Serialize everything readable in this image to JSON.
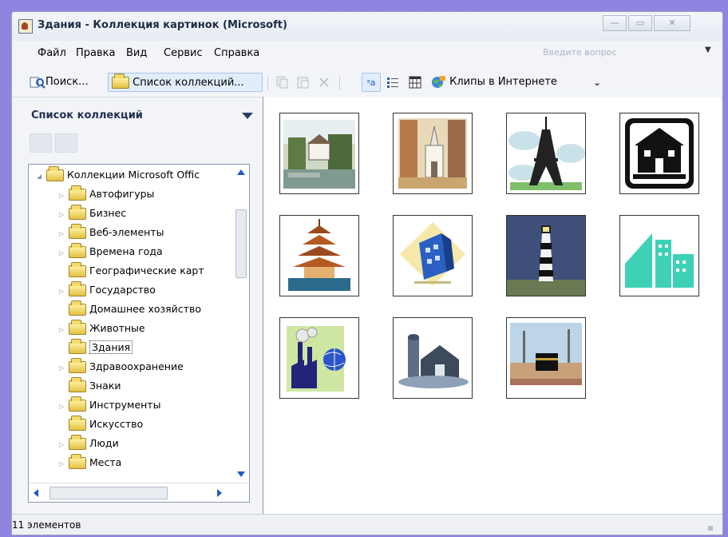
{
  "window": {
    "title": "Здания - Коллекция картинок (Microsoft)"
  },
  "window_controls": {
    "minimize": "—",
    "maximize": "▭",
    "close": "✕"
  },
  "menu": [
    "Файл",
    "Правка",
    "Вид",
    "Сервис",
    "Справка"
  ],
  "help": {
    "placeholder": "Введите вопрос"
  },
  "toolbar": {
    "search": "Поиск...",
    "collections": "Список коллекций...",
    "copy_icon": "copy-icon",
    "paste_icon": "paste-icon",
    "delete_icon": "delete-icon",
    "thumbnails_icon": "thumbnails-view-icon",
    "list_icon": "list-view-icon",
    "details_icon": "details-view-icon",
    "online": "Клипы в Интернете",
    "more": "⌄"
  },
  "left_pane": {
    "title": "Список коллекций",
    "tree": [
      {
        "label": "Коллекции Microsoft Offic",
        "expanded": true,
        "level": 0
      },
      {
        "label": "Автофигуры",
        "level": 1
      },
      {
        "label": "Бизнес",
        "level": 1
      },
      {
        "label": "Веб-элементы",
        "level": 1
      },
      {
        "label": "Времена года",
        "level": 1
      },
      {
        "label": "Географические карт",
        "level": 1
      },
      {
        "label": "Государство",
        "level": 1
      },
      {
        "label": "Домашнее хозяйство",
        "level": 1
      },
      {
        "label": "Животные",
        "level": 1
      },
      {
        "label": "Здания",
        "level": 1,
        "selected": true
      },
      {
        "label": "Здравоохранение",
        "level": 1
      },
      {
        "label": "Знаки",
        "level": 1
      },
      {
        "label": "Инструменты",
        "level": 1
      },
      {
        "label": "Искусство",
        "level": 1
      },
      {
        "label": "Люди",
        "level": 1
      },
      {
        "label": "Места",
        "level": 1
      }
    ]
  },
  "clips": [
    {
      "name": "village-lake-clip"
    },
    {
      "name": "church-painting-clip"
    },
    {
      "name": "eiffel-tower-clip"
    },
    {
      "name": "house-sign-clip"
    },
    {
      "name": "pagoda-clip"
    },
    {
      "name": "blue-skyscraper-clip"
    },
    {
      "name": "lighthouse-clip"
    },
    {
      "name": "teal-building-clip"
    },
    {
      "name": "factory-globe-clip"
    },
    {
      "name": "farm-barn-clip"
    },
    {
      "name": "kaaba-clip"
    }
  ],
  "status": {
    "text": "11 элементов"
  },
  "colors": {
    "background": "#8f84e0",
    "selection_border": "#a8c5ea",
    "scroll_arrow": "#1e58c6"
  }
}
